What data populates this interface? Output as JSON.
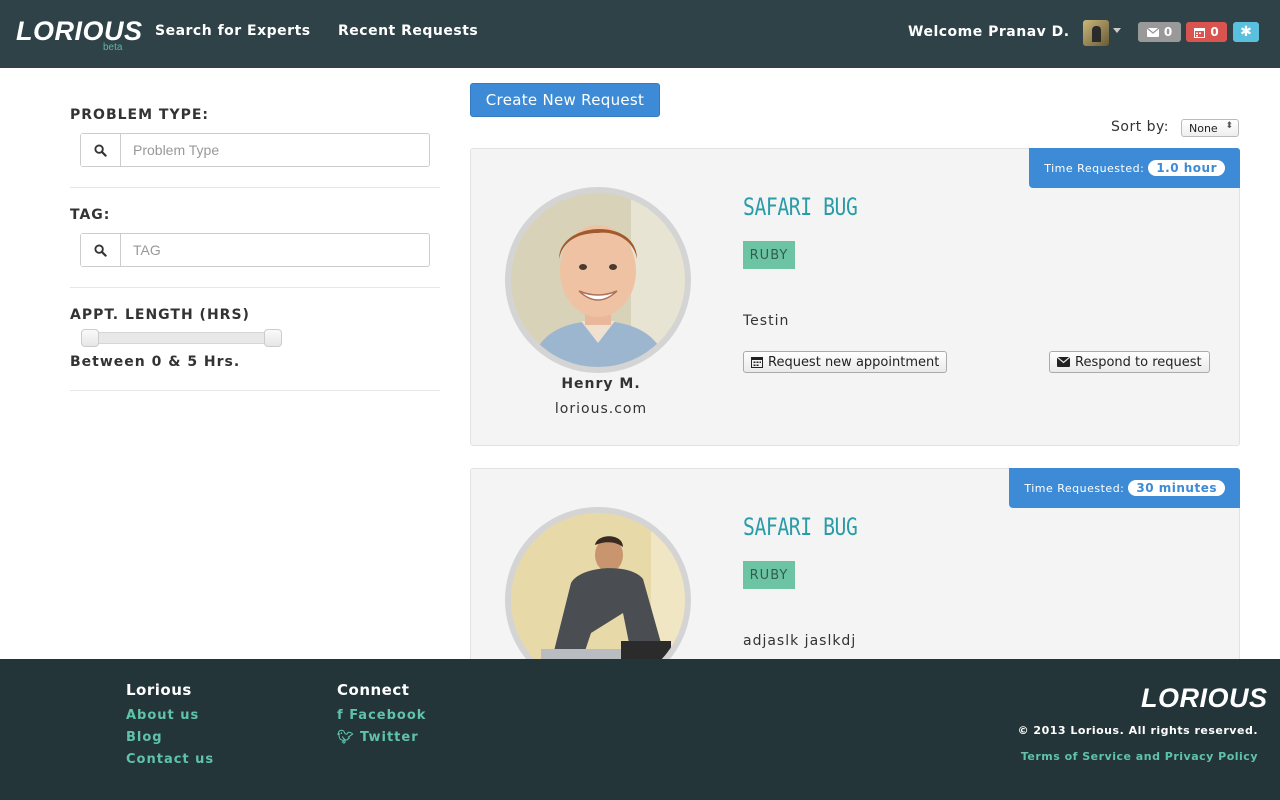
{
  "header": {
    "logo": "LORIOUS",
    "logo_beta": "beta",
    "nav": [
      "Search for Experts",
      "Recent Requests"
    ],
    "welcome": "Welcome Pranav D.",
    "mail_count": "0",
    "calendar_count": "0",
    "icons": {
      "mail": "envelope-icon",
      "calendar": "calendar-icon",
      "settings": "asterisk-icon"
    }
  },
  "sidebar": {
    "problem_type_label": "PROBLEM TYPE:",
    "problem_type_placeholder": "Problem Type",
    "tag_label": "TAG:",
    "tag_placeholder": "TAG",
    "appt_label": "APPT. LENGTH (HRS)",
    "appt_range": "Between 0 & 5 Hrs.",
    "appt_min": 0,
    "appt_max": 5
  },
  "main": {
    "create_button": "Create New Request",
    "sort_label": "Sort by:",
    "sort_value": "None",
    "cards": [
      {
        "time_label": "Time Requested:",
        "time_value": "1.0 hour",
        "title": "SAFARI BUG",
        "tag": "RUBY",
        "description": "Testin",
        "name": "Henry M.",
        "site": "lorious.com",
        "request_button": "Request new appointment",
        "respond_button": "Respond to request"
      },
      {
        "time_label": "Time Requested:",
        "time_value": "30 minutes",
        "title": "SAFARI BUG",
        "tag": "RUBY",
        "description": "adjaslk jaslkdj"
      }
    ]
  },
  "footer": {
    "col1_title": "Lorious",
    "col1_links": [
      "About us",
      "Blog",
      "Contact us"
    ],
    "col2_title": "Connect",
    "col2_links": [
      "Facebook",
      "Twitter"
    ],
    "logo": "LORIOUS",
    "copyright": "© 2013 Lorious. All rights reserved.",
    "terms": "Terms of Service and Privacy Policy"
  },
  "colors": {
    "navbar": "#2e4248",
    "footer": "#243539",
    "accent_blue": "#3d8bd6",
    "accent_teal": "#2a9ca8",
    "tag_green": "#6cc4a4",
    "link_green": "#5fc3a9"
  }
}
